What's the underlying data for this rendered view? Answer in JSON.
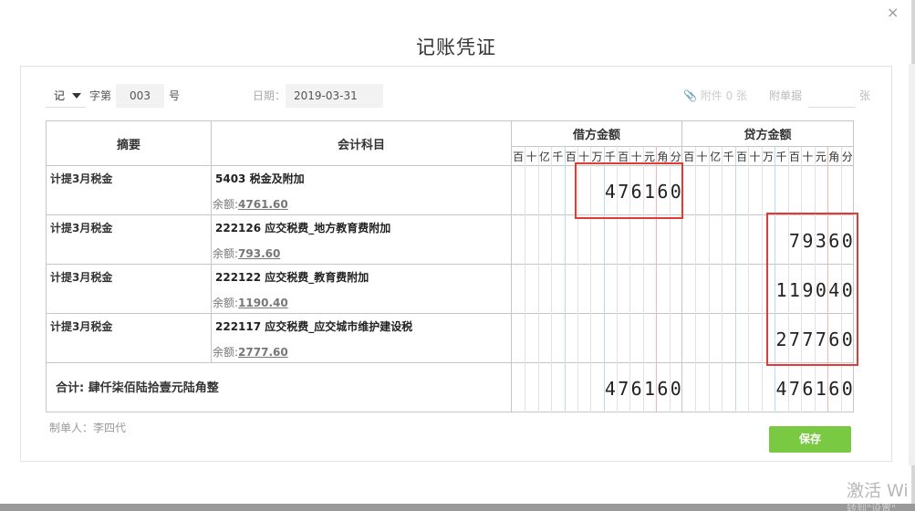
{
  "dialog": {
    "title": "记账凭证",
    "close_glyph": "×"
  },
  "voucher_header": {
    "voucher_word": "记",
    "zi_label": "字第",
    "number": "003",
    "hao_label": "号",
    "date_label": "日期：",
    "date_value": "2019-03-31",
    "attachments_label": "附件 0 张",
    "attachment_docs_label": "附单据",
    "attachment_docs_value": "",
    "zhang_label": "张"
  },
  "columns": {
    "summary": "摘要",
    "account": "会计科目",
    "debit": "借方金额",
    "credit": "贷方金额",
    "digit_headers": [
      "百",
      "十",
      "亿",
      "千",
      "百",
      "十",
      "万",
      "千",
      "百",
      "十",
      "元",
      "角",
      "分"
    ]
  },
  "rows": [
    {
      "summary": "计提3月税金",
      "account": "5403 税金及附加",
      "balance_label": "余额:",
      "balance": "4761.60",
      "debit_digits": "476160",
      "credit_digits": ""
    },
    {
      "summary": "计提3月税金",
      "account": "222126 应交税费_地方教育费附加",
      "balance_label": "余额:",
      "balance": "793.60",
      "debit_digits": "",
      "credit_digits": "79360"
    },
    {
      "summary": "计提3月税金",
      "account": "222122 应交税费_教育费附加",
      "balance_label": "余额:",
      "balance": "1190.40",
      "debit_digits": "",
      "credit_digits": "119040"
    },
    {
      "summary": "计提3月税金",
      "account": "222117 应交税费_应交城市维护建设税",
      "balance_label": "余额:",
      "balance": "2777.60",
      "debit_digits": "",
      "credit_digits": "277760"
    }
  ],
  "total": {
    "label": "合计:  肆仟柒佰陆拾壹元陆角整",
    "debit_digits": "476160",
    "credit_digits": "476160"
  },
  "footer": {
    "maker": "制单人：李四代",
    "save_label": "保存"
  },
  "watermark": {
    "line1": "激活 Wi",
    "line2": "转到\"设置\""
  },
  "colors": {
    "save": "#7ac943",
    "highlight": "#e53935",
    "grid_blue": "#b9dcef",
    "grid_red": "#f2b8b8"
  }
}
